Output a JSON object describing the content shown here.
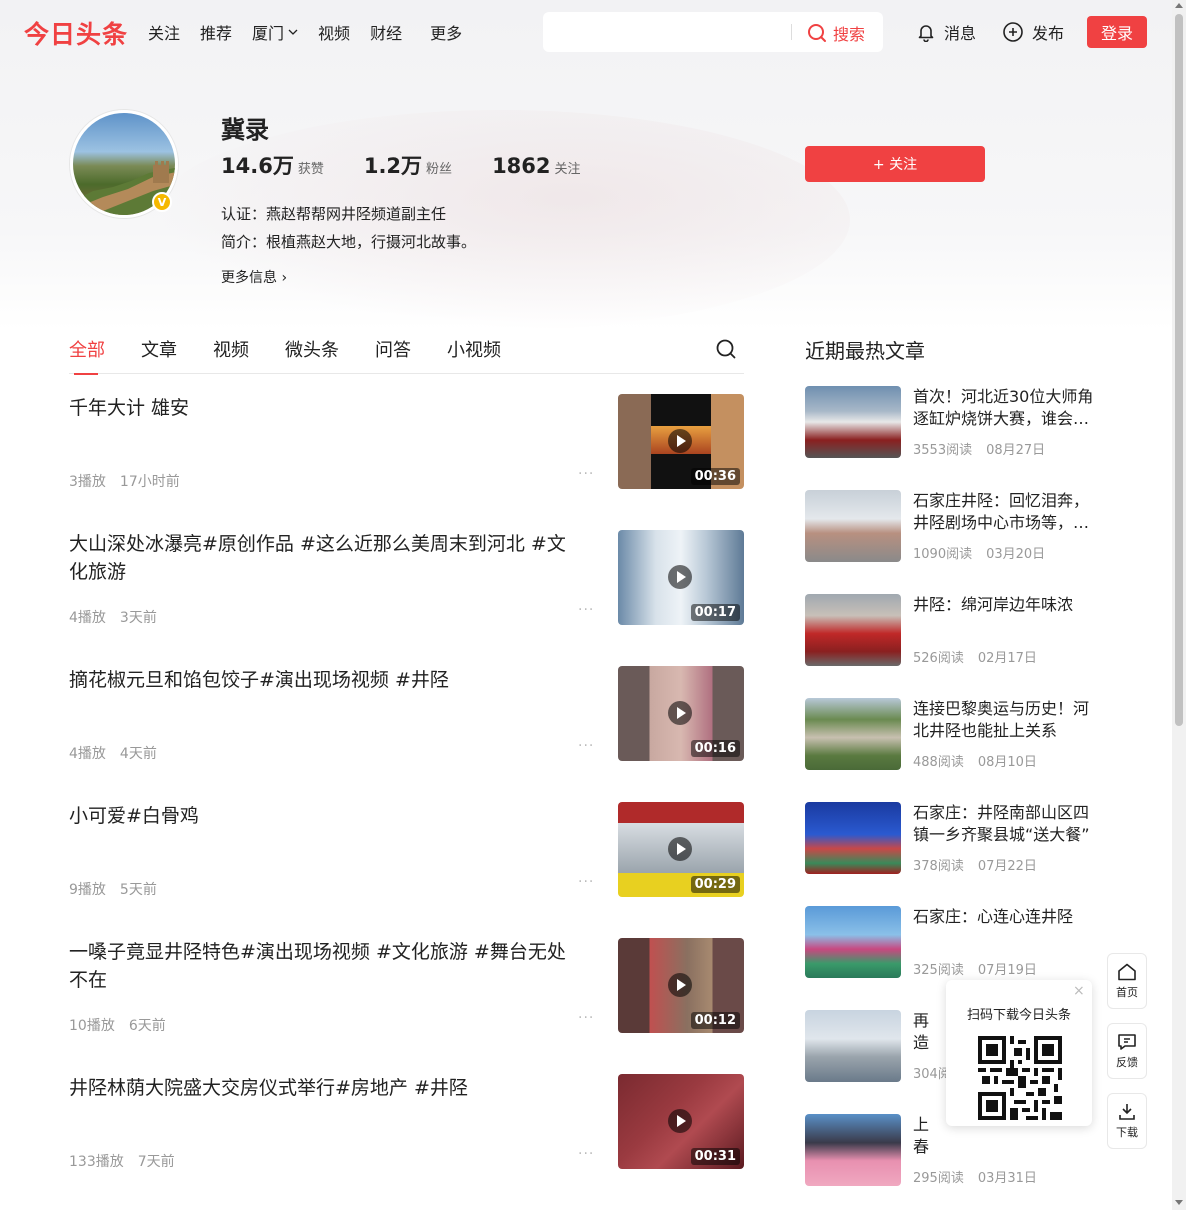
{
  "header": {
    "logo": "今日头条",
    "nav": [
      "关注",
      "推荐",
      "厦门",
      "视频",
      "财经",
      "更多"
    ],
    "search_placeholder": "",
    "search_label": "搜索",
    "messages_label": "消息",
    "publish_label": "发布",
    "login_label": "登录"
  },
  "colors": {
    "accent": "#f04142",
    "verified": "#f5b800"
  },
  "profile": {
    "name": "冀录",
    "stats": [
      {
        "num": "14.6万",
        "label": "获赞"
      },
      {
        "num": "1.2万",
        "label": "粉丝"
      },
      {
        "num": "1862",
        "label": "关注"
      }
    ],
    "verified_badge": "V",
    "cert": "认证：燕赵帮帮网井陉频道副主任",
    "intro": "简介：根植燕赵大地，行摄河北故事。",
    "more_info": "更多信息 ›",
    "follow_label": "+ 关注"
  },
  "tabs": [
    "全部",
    "文章",
    "视频",
    "微头条",
    "问答",
    "小视频"
  ],
  "feed": [
    {
      "title": "千年大计 雄安",
      "plays": "3播放",
      "time": "17小时前",
      "duration": "00:36"
    },
    {
      "title": "大山深处冰瀑亮#原创作品 #这么近那么美周末到河北 #文化旅游",
      "plays": "4播放",
      "time": "3天前",
      "duration": "00:17"
    },
    {
      "title": "摘花椒元旦和馅包饺子#演出现场视频 #井陉",
      "plays": "4播放",
      "time": "4天前",
      "duration": "00:16"
    },
    {
      "title": "小可爱#白骨鸡",
      "plays": "9播放",
      "time": "5天前",
      "duration": "00:29"
    },
    {
      "title": "一嗓子竟显井陉特色#演出现场视频 #文化旅游 #舞台无处不在",
      "plays": "10播放",
      "time": "6天前",
      "duration": "00:12"
    },
    {
      "title": "井陉林荫大院盛大交房仪式举行#房地产 #井陉",
      "plays": "133播放",
      "time": "7天前",
      "duration": "00:31"
    }
  ],
  "feed_dots": "···",
  "sidebar": {
    "title": "近期最热文章",
    "items": [
      {
        "title": "首次！河北近30位大师角逐缸炉烧饼大赛，谁会…",
        "reads": "3553阅读",
        "date": "08月27日"
      },
      {
        "title": "石家庄井陉：回忆泪奔，井陉剧场中心市场等，…",
        "reads": "1090阅读",
        "date": "03月20日"
      },
      {
        "title": "井陉：绵河岸边年味浓",
        "reads": "526阅读",
        "date": "02月17日"
      },
      {
        "title": "连接巴黎奥运与历史！河北井陉也能扯上关系",
        "reads": "488阅读",
        "date": "08月10日"
      },
      {
        "title": "石家庄：井陉南部山区四镇一乡齐聚县城“送大餐”",
        "reads": "378阅读",
        "date": "07月22日"
      },
      {
        "title": "石家庄：心连心连井陉",
        "reads": "325阅读",
        "date": "07月19日"
      },
      {
        "title": "再造安区",
        "reads": "304阅",
        "date": ""
      },
      {
        "title": "上春花儿",
        "reads": "295阅读",
        "date": "03月31日"
      }
    ]
  },
  "qr": {
    "title": "扫码下载今日头条",
    "close": "×"
  },
  "side_tools": [
    "首页",
    "反馈",
    "下载"
  ]
}
